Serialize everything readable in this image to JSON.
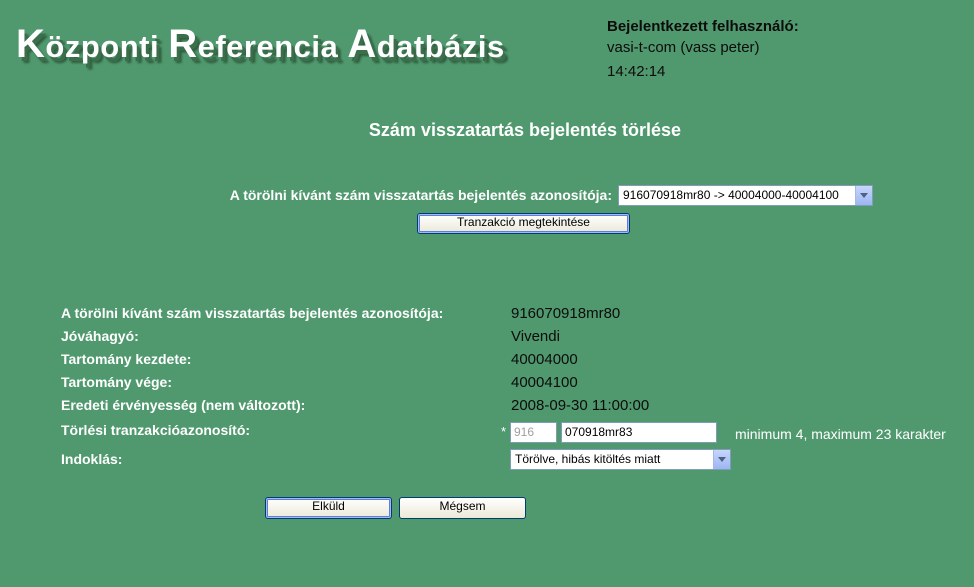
{
  "header": {
    "logo_parts": [
      "K",
      "özponti ",
      "R",
      "eferencia ",
      "A",
      "datbázis"
    ],
    "logged_in_label": "Bejelentkezett felhasználó:",
    "user": "vasi-t-com (vass peter)",
    "time": "14:42:14"
  },
  "page_title": "Szám visszatartás bejelentés törlése",
  "selector": {
    "label": "A törölni kívánt szám visszatartás bejelentés azonosítója:",
    "selected": "916070918mr80 -> 40004000-40004100",
    "view_button": "Tranzakció megtekintése"
  },
  "details": [
    {
      "key": "A törölni kívánt szám visszatartás bejelentés azonosítója:",
      "value": "916070918mr80"
    },
    {
      "key": "Jóváhagyó:",
      "value": "Vivendi"
    },
    {
      "key": "Tartomány kezdete:",
      "value": "40004000"
    },
    {
      "key": "Tartomány vége:",
      "value": "40004100"
    },
    {
      "key": "Eredeti érvényesség (nem változott):",
      "value": "2008-09-30 11:00:00"
    }
  ],
  "delete_tx": {
    "label": "Törlési tranzakcióazonosító:",
    "required_mark": "*",
    "prefix": "916",
    "value": "070918mr83",
    "hint": "minimum 4, maximum 23 karakter"
  },
  "reason": {
    "label": "Indoklás:",
    "selected": "Törölve, hibás kitöltés miatt"
  },
  "buttons": {
    "submit": "Elküld",
    "cancel": "Mégsem"
  }
}
